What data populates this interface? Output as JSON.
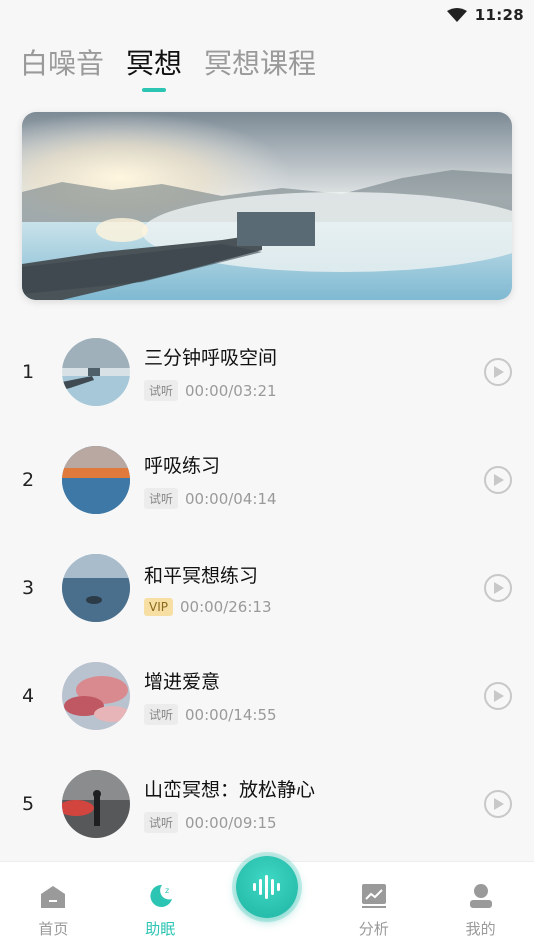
{
  "status_bar": {
    "time": "11:28"
  },
  "tabs": [
    {
      "label": "白噪音",
      "active": false
    },
    {
      "label": "冥想",
      "active": true
    },
    {
      "label": "冥想课程",
      "active": false
    }
  ],
  "tracks": [
    {
      "index": "1",
      "title": "三分钟呼吸空间",
      "tag": "试听",
      "duration": "00:00/03:21"
    },
    {
      "index": "2",
      "title": "呼吸练习",
      "tag": "试听",
      "duration": "00:00/04:14"
    },
    {
      "index": "3",
      "title": "和平冥想练习",
      "tag": "VIP",
      "duration": "00:00/26:13"
    },
    {
      "index": "4",
      "title": "增进爱意",
      "tag": "试听",
      "duration": "00:00/14:55"
    },
    {
      "index": "5",
      "title": "山峦冥想：放松静心",
      "tag": "试听",
      "duration": "00:00/09:15"
    }
  ],
  "bottom_nav": {
    "home": "首页",
    "sleep": "助眠",
    "analysis": "分析",
    "mine": "我的"
  },
  "colors": {
    "accent": "#2cc5b4",
    "vip_tag": "#f7dfa3"
  },
  "icons": {
    "status": [
      "wifi-icon"
    ],
    "track_action": "play-icon",
    "nav": [
      "home-icon",
      "moon-icon",
      "sound-wave-icon",
      "chart-icon",
      "person-icon"
    ]
  }
}
